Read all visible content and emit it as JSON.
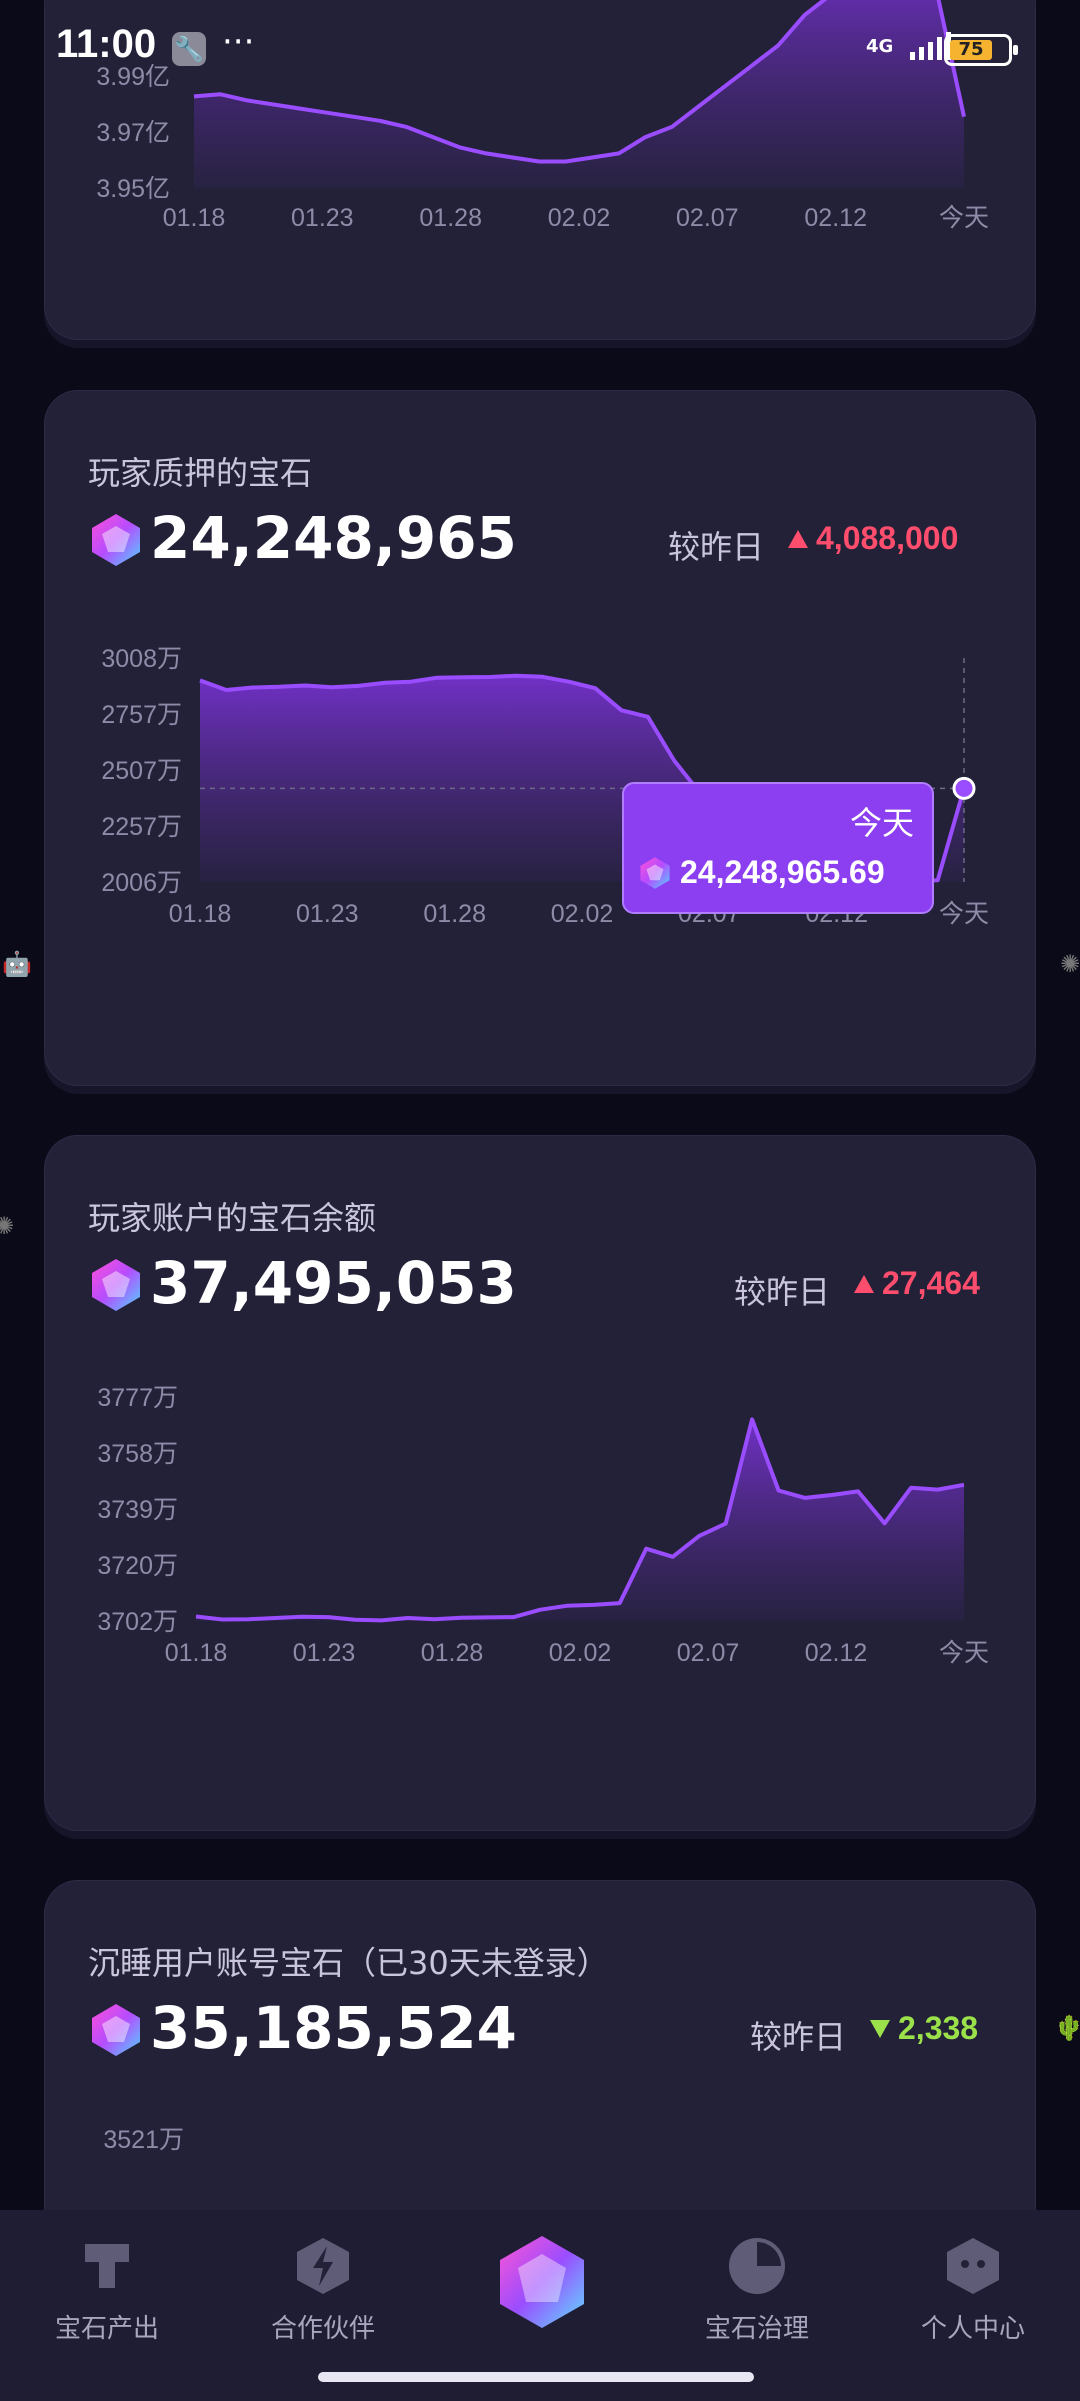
{
  "status": {
    "time": "11:00",
    "network": "4G",
    "battery": "75"
  },
  "top_card": {
    "y_ticks": [
      "3.99亿",
      "3.97亿",
      "3.95亿"
    ],
    "x_ticks": [
      "01.18",
      "01.23",
      "01.28",
      "02.02",
      "02.07",
      "02.12",
      "今天"
    ]
  },
  "staked_card": {
    "title": "玩家质押的宝石",
    "value": "24,248,965",
    "delta_label": "较昨日",
    "delta_value": "4,088,000",
    "delta_direction": "up",
    "tooltip": {
      "label": "今天",
      "value": "24,248,965.69"
    },
    "y_ticks": [
      "3008万",
      "2757万",
      "2507万",
      "2257万",
      "2006万"
    ],
    "x_ticks": [
      "01.18",
      "01.23",
      "01.28",
      "02.02",
      "02.07",
      "02.12",
      "今天"
    ]
  },
  "balance_card": {
    "title": "玩家账户的宝石余额",
    "value": "37,495,053",
    "delta_label": "较昨日",
    "delta_value": "27,464",
    "delta_direction": "up",
    "y_ticks": [
      "3777万",
      "3758万",
      "3739万",
      "3720万",
      "3702万"
    ],
    "x_ticks": [
      "01.18",
      "01.23",
      "01.28",
      "02.02",
      "02.07",
      "02.12",
      "今天"
    ]
  },
  "dormant_card": {
    "title": "沉睡用户账号宝石（已30天未登录）",
    "value": "35,185,524",
    "delta_label": "较昨日",
    "delta_value": "2,338",
    "delta_direction": "down",
    "y_ticks": [
      "3521万"
    ]
  },
  "bottom_nav": [
    {
      "label": "宝石产出",
      "icon": "t-shape-icon"
    },
    {
      "label": "合作伙伴",
      "icon": "lightning-icon"
    },
    {
      "label": "",
      "icon": "gem-icon"
    },
    {
      "label": "宝石治理",
      "icon": "pie-chart-icon"
    },
    {
      "label": "个人中心",
      "icon": "face-icon"
    }
  ],
  "colors": {
    "accent": "#8b3ff0",
    "up": "#ff4d6d",
    "down": "#9be24a",
    "card": "#232138"
  },
  "chart_data": [
    {
      "type": "area",
      "title": "",
      "x": [
        "01.18",
        "01.19",
        "01.20",
        "01.21",
        "01.22",
        "01.23",
        "01.24",
        "01.25",
        "01.26",
        "01.27",
        "01.28",
        "01.29",
        "01.30",
        "01.31",
        "02.01",
        "02.02",
        "02.03",
        "02.04",
        "02.05",
        "02.06",
        "02.07",
        "02.08",
        "02.09",
        "02.10",
        "02.11",
        "02.12",
        "02.13",
        "02.14",
        "02.15",
        "今天"
      ],
      "series": [
        {
          "values": [
            3.99,
            3.991,
            3.988,
            3.986,
            3.984,
            3.982,
            3.98,
            3.978,
            3.975,
            3.97,
            3.965,
            3.962,
            3.96,
            3.958,
            3.958,
            3.96,
            3.962,
            3.97,
            3.975,
            3.985,
            3.995,
            4.005,
            4.015,
            4.03,
            4.04,
            4.05,
            4.055,
            4.06,
            4.04,
            3.98
          ]
        }
      ],
      "ylim": [
        3.945,
        4.0
      ],
      "unit": "亿"
    },
    {
      "type": "area",
      "title": "玩家质押的宝石",
      "x": [
        "01.18",
        "01.19",
        "01.20",
        "01.21",
        "01.22",
        "01.23",
        "01.24",
        "01.25",
        "01.26",
        "01.27",
        "01.28",
        "01.29",
        "01.30",
        "01.31",
        "02.01",
        "02.02",
        "02.03",
        "02.04",
        "02.05",
        "02.06",
        "02.07",
        "02.08",
        "02.09",
        "02.10",
        "02.11",
        "02.12",
        "02.13",
        "02.14",
        "02.15",
        "今天"
      ],
      "series": [
        {
          "values": [
            2908,
            2865,
            2876,
            2879,
            2885,
            2877,
            2883,
            2897,
            2902,
            2920,
            2922,
            2923,
            2929,
            2924,
            2902,
            2873,
            2774,
            2745,
            2549,
            2400,
            2278,
            2200,
            2150,
            2108,
            2096,
            2058,
            2020,
            2012,
            2014,
            2425
          ]
        }
      ],
      "ylim": [
        2006,
        3008
      ],
      "unit": "万"
    },
    {
      "type": "area",
      "title": "玩家账户的宝石余额",
      "x": [
        "01.18",
        "01.19",
        "01.20",
        "01.21",
        "01.22",
        "01.23",
        "01.24",
        "01.25",
        "01.26",
        "01.27",
        "01.28",
        "01.29",
        "01.30",
        "01.31",
        "02.01",
        "02.02",
        "02.03",
        "02.04",
        "02.05",
        "02.06",
        "02.07",
        "02.08",
        "02.09",
        "02.10",
        "02.11",
        "02.12",
        "02.13",
        "02.14",
        "02.15",
        "今天"
      ],
      "series": [
        {
          "values": [
            3703.5,
            3702.5,
            3702.6,
            3703.0,
            3703.4,
            3703.3,
            3702.4,
            3702.2,
            3703.0,
            3702.6,
            3703.1,
            3703.2,
            3703.3,
            3705.8,
            3707.1,
            3707.4,
            3708.0,
            3726.2,
            3723.5,
            3730.5,
            3734.6,
            3769.5,
            3745.7,
            3743.2,
            3744.2,
            3745.4,
            3734.7,
            3746.6,
            3746.0,
            3747.6
          ]
        }
      ],
      "ylim": [
        3702,
        3777
      ],
      "unit": "万"
    }
  ]
}
